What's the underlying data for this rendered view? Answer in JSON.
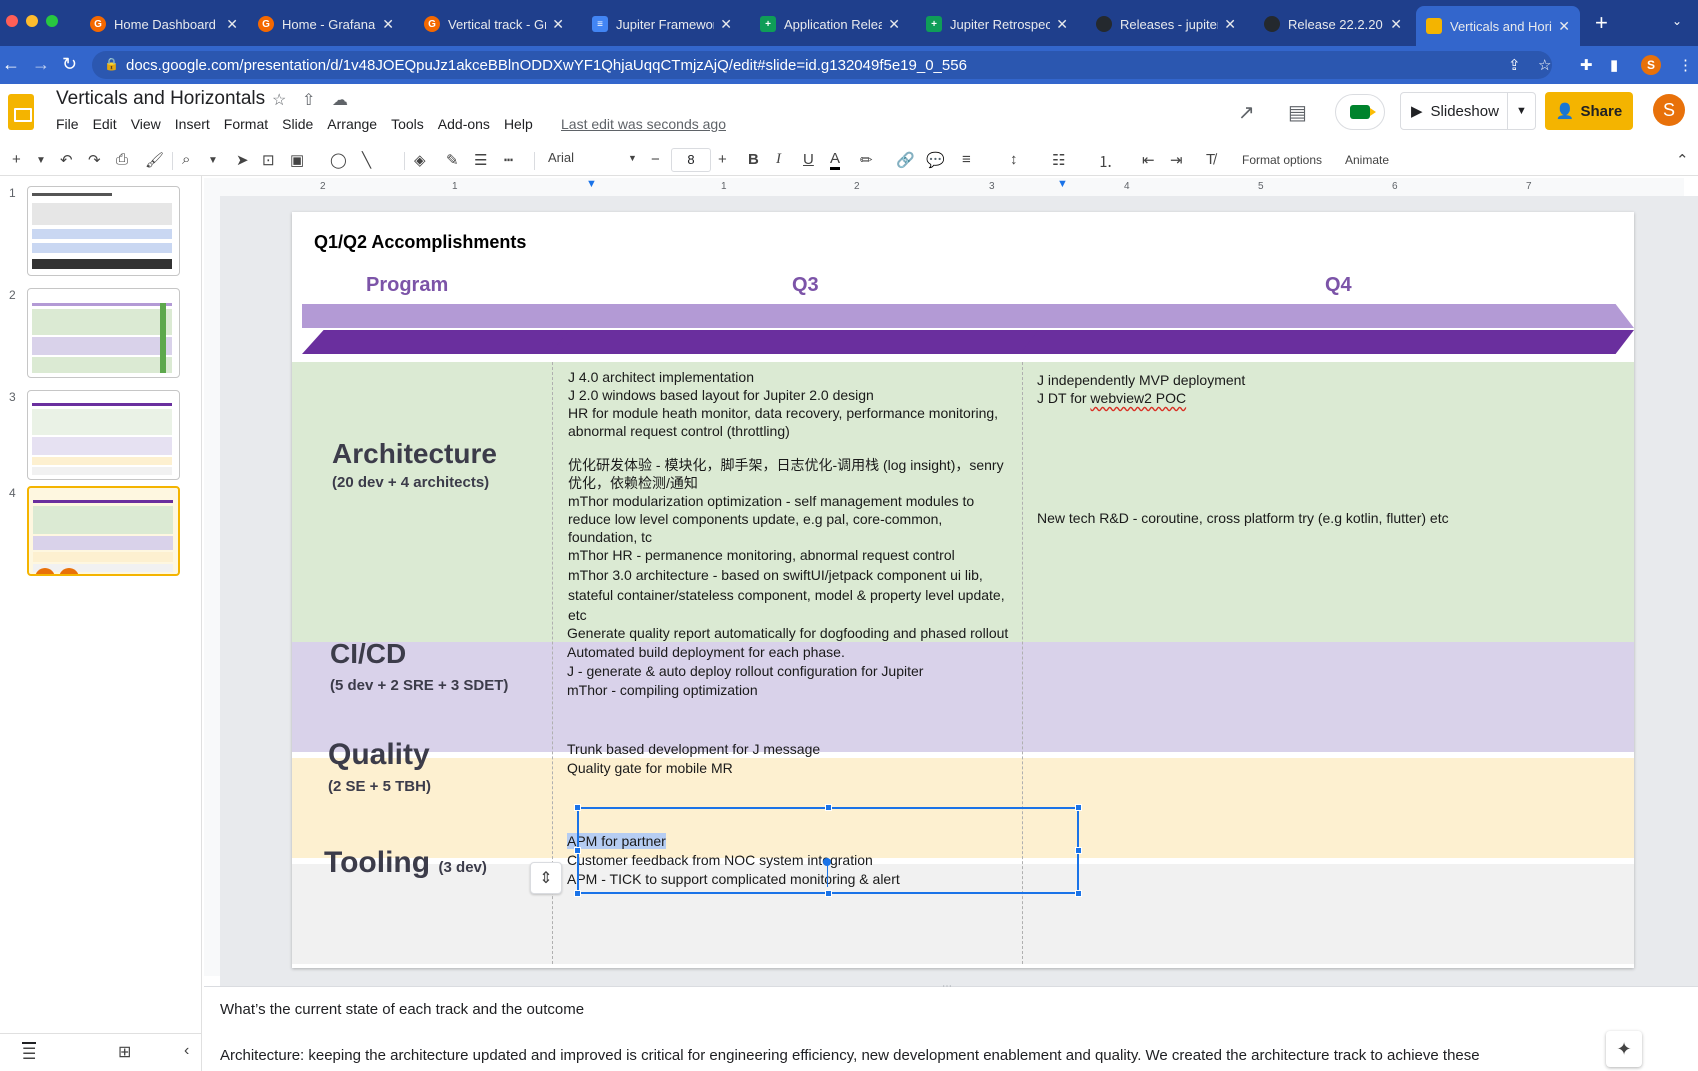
{
  "colors": {
    "tabstrip": "#1f3f8c",
    "addrbar": "#3366cc",
    "share_button": "#f4b400",
    "program_header": "#7c54a8",
    "arch_band": "#dbead3",
    "cicd_band": "#d9d2ea",
    "quality_band": "#fdf0d0",
    "tooling_band": "#f1f1f1",
    "selection": "#1a73e8"
  },
  "browser": {
    "tabs": [
      {
        "label": "Home Dashboard",
        "icon": "grafana-icon"
      },
      {
        "label": "Home - Grafana",
        "icon": "grafana-icon"
      },
      {
        "label": "Vertical track - Gr",
        "icon": "grafana-icon"
      },
      {
        "label": "Jupiter Framework",
        "icon": "docs-icon"
      },
      {
        "label": "Application Releas",
        "icon": "sheets-icon"
      },
      {
        "label": "Jupiter Retrospect",
        "icon": "sheets-icon"
      },
      {
        "label": "Releases - jupiter-",
        "icon": "github-icon"
      },
      {
        "label": "Release 22.2.20 -",
        "icon": "github-icon"
      },
      {
        "label": "Verticals and Hori",
        "icon": "slides-icon",
        "active": true
      }
    ],
    "new_tab": "+",
    "url": "docs.google.com/presentation/d/1v48JOEQpuJz1akceBBlnODDXwYF1QhjaUqqCTmjzAjQ/edit#slide=id.g132049f5e19_0_556",
    "profile_initial": "S"
  },
  "app": {
    "title": "Verticals and Horizontals",
    "menu": [
      "File",
      "Edit",
      "View",
      "Insert",
      "Format",
      "Slide",
      "Arrange",
      "Tools",
      "Add-ons",
      "Help"
    ],
    "last_edit": "Last edit was seconds ago",
    "slideshow_label": "Slideshow",
    "share_label": "Share",
    "user_initial": "S"
  },
  "toolbar": {
    "font": "Arial",
    "font_size": "8",
    "format_options": "Format options",
    "animate": "Animate"
  },
  "filmstrip": {
    "slides": [
      "1",
      "2",
      "3",
      "4"
    ],
    "selected": 4
  },
  "ruler": {
    "h_marks": [
      "2",
      "1",
      "1",
      "2",
      "3",
      "4",
      "5",
      "6",
      "7"
    ]
  },
  "slide": {
    "title": "Q1/Q2 Accomplishments",
    "headers": {
      "program": "Program",
      "q3": "Q3",
      "q4": "Q4"
    },
    "tracks": {
      "architecture": {
        "name": "Architecture",
        "team": "(20 dev + 4 architects)",
        "q3": [
          "J 4.0 architect implementation",
          "J  2.0 windows based layout for Jupiter 2.0 design",
          "HR for module heath monitor, data recovery, performance monitoring,",
          "abnormal request control (throttling)",
          "优化研发体验 - 模块化，脚手架，日志优化-调用栈 (log insight)，senry",
          "优化，依赖检测/通知",
          "mThor modularization optimization - self management modules to",
          "reduce low level components update, e.g pal, core-common,",
          "foundation, tc",
          "mThor HR - permanence monitoring, abnormal request control",
          "mThor 3.0 architecture - based on swiftUI/jetpack component ui lib,",
          "stateful container/stateless component, model & property level update,",
          "etc"
        ],
        "q4": [
          "J independently MVP deployment",
          "J DT for ",
          "webview2 POC",
          "New tech R&D - coroutine,  cross platform try (e.g kotlin, flutter) etc"
        ]
      },
      "cicd": {
        "name": "CI/CD",
        "team": "(5 dev + 2 SRE + 3 SDET)",
        "q3": [
          "Generate quality report automatically for dogfooding and phased rollout",
          "Automated build deployment for each phase.",
          "J -  generate & auto deploy rollout configuration for Jupiter",
          "mThor - compiling optimization"
        ]
      },
      "quality": {
        "name": "Quality",
        "team": "(2 SE + 5 TBH)",
        "q3": [
          "Trunk based development for J message",
          "Quality gate for mobile MR"
        ]
      },
      "tooling": {
        "name": "Tooling",
        "team": "(3 dev)",
        "q3": [
          "APM for partner",
          "Customer feedback from NOC system integration",
          "APM - TICK to support complicated monitoring & alert"
        ]
      }
    }
  },
  "notes": {
    "line1": "What’s the current state of each track and the outcome",
    "line2": "Architecture: keeping the architecture updated and improved is critical for engineering efficiency, new development enablement and quality. We created the architecture track to achieve these"
  }
}
